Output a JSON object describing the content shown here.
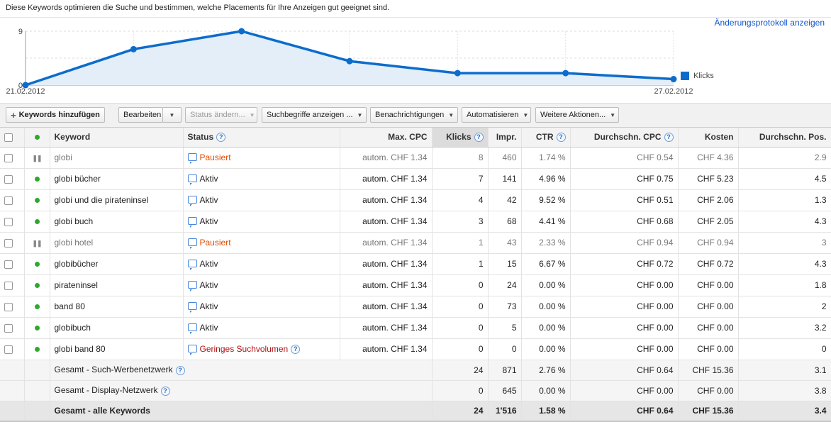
{
  "header": {
    "description": "Diese Keywords optimieren die Suche und bestimmen, welche Placements für Ihre Anzeigen gut geeignet sind.",
    "change_log_link": "Änderungsprotokoll anzeigen"
  },
  "chart_data": {
    "type": "area",
    "series": [
      {
        "name": "Klicks",
        "values": [
          0,
          6,
          9,
          4,
          2,
          2,
          1
        ]
      }
    ],
    "x": [
      "21.02.2012",
      "22.02.2012",
      "23.02.2012",
      "24.02.2012",
      "25.02.2012",
      "26.02.2012",
      "27.02.2012"
    ],
    "x_tick_labels": [
      "21.02.2012",
      "27.02.2012"
    ],
    "y_tick_labels": [
      "0",
      "9"
    ],
    "ylim": [
      0,
      9
    ],
    "color": "#0c6ccc",
    "fill": "#e3eef9",
    "legend_position": "right",
    "grid": true
  },
  "toolbar": {
    "add_keywords": "Keywords hinzufügen",
    "edit": "Bearbeiten",
    "change_status": "Status ändern...",
    "search_terms": "Suchbegriffe anzeigen ...",
    "notifications": "Benachrichtigungen",
    "automate": "Automatisieren",
    "more_actions": "Weitere Aktionen..."
  },
  "table": {
    "headers": {
      "keyword": "Keyword",
      "status": "Status",
      "max_cpc": "Max. CPC",
      "clicks": "Klicks",
      "impr": "Impr.",
      "ctr": "CTR",
      "avg_cpc": "Durchschn. CPC",
      "cost": "Kosten",
      "avg_pos": "Durchschn. Pos."
    },
    "rows": [
      {
        "keyword": "globi",
        "status": "Pausiert",
        "max_cpc": "autom. CHF 1.34",
        "clicks": "8",
        "impr": "460",
        "ctr": "1.74 %",
        "avg_cpc": "CHF 0.54",
        "cost": "CHF 4.36",
        "avg_pos": "2.9"
      },
      {
        "keyword": "globi bücher",
        "status": "Aktiv",
        "max_cpc": "autom. CHF 1.34",
        "clicks": "7",
        "impr": "141",
        "ctr": "4.96 %",
        "avg_cpc": "CHF 0.75",
        "cost": "CHF 5.23",
        "avg_pos": "4.5"
      },
      {
        "keyword": "globi und die pirateninsel",
        "status": "Aktiv",
        "max_cpc": "autom. CHF 1.34",
        "clicks": "4",
        "impr": "42",
        "ctr": "9.52 %",
        "avg_cpc": "CHF 0.51",
        "cost": "CHF 2.06",
        "avg_pos": "1.3"
      },
      {
        "keyword": "globi buch",
        "status": "Aktiv",
        "max_cpc": "autom. CHF 1.34",
        "clicks": "3",
        "impr": "68",
        "ctr": "4.41 %",
        "avg_cpc": "CHF 0.68",
        "cost": "CHF 2.05",
        "avg_pos": "4.3"
      },
      {
        "keyword": "globi hotel",
        "status": "Pausiert",
        "max_cpc": "autom. CHF 1.34",
        "clicks": "1",
        "impr": "43",
        "ctr": "2.33 %",
        "avg_cpc": "CHF 0.94",
        "cost": "CHF 0.94",
        "avg_pos": "3"
      },
      {
        "keyword": "globibücher",
        "status": "Aktiv",
        "max_cpc": "autom. CHF 1.34",
        "clicks": "1",
        "impr": "15",
        "ctr": "6.67 %",
        "avg_cpc": "CHF 0.72",
        "cost": "CHF 0.72",
        "avg_pos": "4.3"
      },
      {
        "keyword": "pirateninsel",
        "status": "Aktiv",
        "max_cpc": "autom. CHF 1.34",
        "clicks": "0",
        "impr": "24",
        "ctr": "0.00 %",
        "avg_cpc": "CHF 0.00",
        "cost": "CHF 0.00",
        "avg_pos": "1.8"
      },
      {
        "keyword": "band 80",
        "status": "Aktiv",
        "max_cpc": "autom. CHF 1.34",
        "clicks": "0",
        "impr": "73",
        "ctr": "0.00 %",
        "avg_cpc": "CHF 0.00",
        "cost": "CHF 0.00",
        "avg_pos": "2"
      },
      {
        "keyword": "globibuch",
        "status": "Aktiv",
        "max_cpc": "autom. CHF 1.34",
        "clicks": "0",
        "impr": "5",
        "ctr": "0.00 %",
        "avg_cpc": "CHF 0.00",
        "cost": "CHF 0.00",
        "avg_pos": "3.2"
      },
      {
        "keyword": "globi band 80",
        "status": "Geringes Suchvolumen",
        "max_cpc": "autom. CHF 1.34",
        "clicks": "0",
        "impr": "0",
        "ctr": "0.00 %",
        "avg_cpc": "CHF 0.00",
        "cost": "CHF 0.00",
        "avg_pos": "0"
      }
    ],
    "totals": [
      {
        "label": "Gesamt - Such-Werbenetzwerk",
        "clicks": "24",
        "impr": "871",
        "ctr": "2.76 %",
        "avg_cpc": "CHF 0.64",
        "cost": "CHF 15.36",
        "avg_pos": "3.1"
      },
      {
        "label": "Gesamt - Display-Netzwerk",
        "clicks": "0",
        "impr": "645",
        "ctr": "0.00 %",
        "avg_cpc": "CHF 0.00",
        "cost": "CHF 0.00",
        "avg_pos": "3.8"
      },
      {
        "label": "Gesamt - alle Keywords",
        "clicks": "24",
        "impr": "1'516",
        "ctr": "1.58 %",
        "avg_cpc": "CHF 0.64",
        "cost": "CHF 15.36",
        "avg_pos": "3.4"
      }
    ]
  }
}
